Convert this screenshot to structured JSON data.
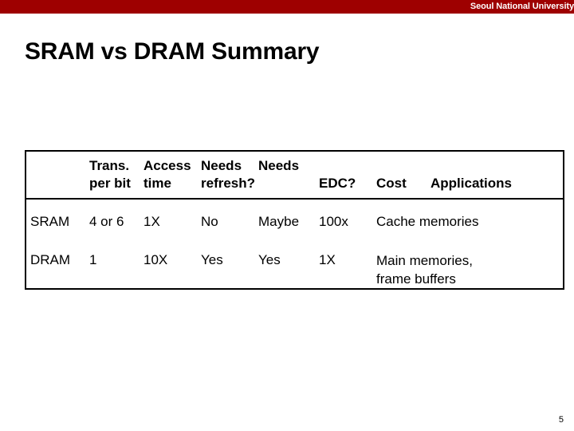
{
  "banner": {
    "institution": "Seoul National University",
    "color": "#9e0000"
  },
  "slide": {
    "title": "SRAM vs DRAM Summary",
    "page_number": "5"
  },
  "table": {
    "headers": [
      {
        "line1": "",
        "line2": ""
      },
      {
        "line1": "Trans.",
        "line2": "per bit"
      },
      {
        "line1": "Access",
        "line2": "time"
      },
      {
        "line1": "Needs",
        "line2": "refresh?"
      },
      {
        "line1": "Needs",
        "line2": ""
      },
      {
        "line1": "",
        "line2": "EDC?"
      },
      {
        "line1": "",
        "line2": "Cost"
      },
      {
        "line1": "",
        "line2": "Applications"
      }
    ],
    "rows": [
      {
        "name": "SRAM",
        "trans_per_bit": "4 or 6",
        "access_time": "1X",
        "needs_refresh": "No",
        "needs_edc": "Maybe",
        "cost": "100x",
        "applications": "Cache memories"
      },
      {
        "name": "DRAM",
        "trans_per_bit": "1",
        "access_time": "10X",
        "needs_refresh": "Yes",
        "needs_edc": "Yes",
        "cost": "1X",
        "applications": "Main memories,\nframe buffers"
      }
    ]
  }
}
